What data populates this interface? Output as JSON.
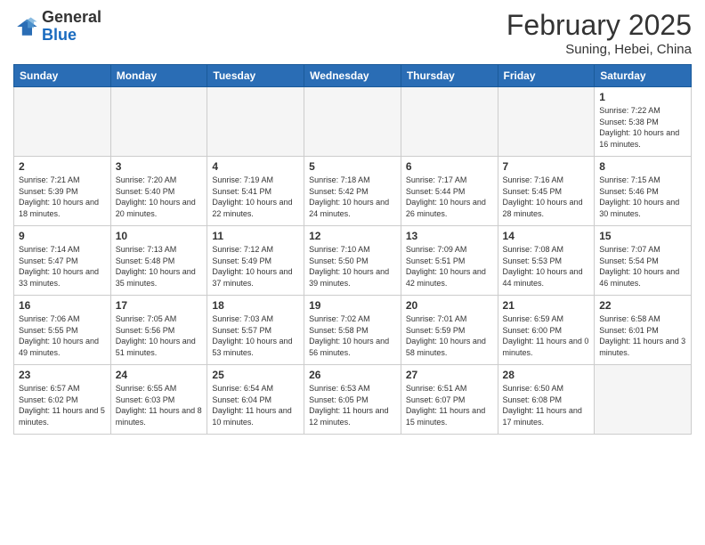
{
  "header": {
    "logo_general": "General",
    "logo_blue": "Blue",
    "title": "February 2025",
    "subtitle": "Suning, Hebei, China"
  },
  "weekdays": [
    "Sunday",
    "Monday",
    "Tuesday",
    "Wednesday",
    "Thursday",
    "Friday",
    "Saturday"
  ],
  "weeks": [
    [
      {
        "day": "",
        "info": ""
      },
      {
        "day": "",
        "info": ""
      },
      {
        "day": "",
        "info": ""
      },
      {
        "day": "",
        "info": ""
      },
      {
        "day": "",
        "info": ""
      },
      {
        "day": "",
        "info": ""
      },
      {
        "day": "1",
        "info": "Sunrise: 7:22 AM\nSunset: 5:38 PM\nDaylight: 10 hours\nand 16 minutes."
      }
    ],
    [
      {
        "day": "2",
        "info": "Sunrise: 7:21 AM\nSunset: 5:39 PM\nDaylight: 10 hours\nand 18 minutes."
      },
      {
        "day": "3",
        "info": "Sunrise: 7:20 AM\nSunset: 5:40 PM\nDaylight: 10 hours\nand 20 minutes."
      },
      {
        "day": "4",
        "info": "Sunrise: 7:19 AM\nSunset: 5:41 PM\nDaylight: 10 hours\nand 22 minutes."
      },
      {
        "day": "5",
        "info": "Sunrise: 7:18 AM\nSunset: 5:42 PM\nDaylight: 10 hours\nand 24 minutes."
      },
      {
        "day": "6",
        "info": "Sunrise: 7:17 AM\nSunset: 5:44 PM\nDaylight: 10 hours\nand 26 minutes."
      },
      {
        "day": "7",
        "info": "Sunrise: 7:16 AM\nSunset: 5:45 PM\nDaylight: 10 hours\nand 28 minutes."
      },
      {
        "day": "8",
        "info": "Sunrise: 7:15 AM\nSunset: 5:46 PM\nDaylight: 10 hours\nand 30 minutes."
      }
    ],
    [
      {
        "day": "9",
        "info": "Sunrise: 7:14 AM\nSunset: 5:47 PM\nDaylight: 10 hours\nand 33 minutes."
      },
      {
        "day": "10",
        "info": "Sunrise: 7:13 AM\nSunset: 5:48 PM\nDaylight: 10 hours\nand 35 minutes."
      },
      {
        "day": "11",
        "info": "Sunrise: 7:12 AM\nSunset: 5:49 PM\nDaylight: 10 hours\nand 37 minutes."
      },
      {
        "day": "12",
        "info": "Sunrise: 7:10 AM\nSunset: 5:50 PM\nDaylight: 10 hours\nand 39 minutes."
      },
      {
        "day": "13",
        "info": "Sunrise: 7:09 AM\nSunset: 5:51 PM\nDaylight: 10 hours\nand 42 minutes."
      },
      {
        "day": "14",
        "info": "Sunrise: 7:08 AM\nSunset: 5:53 PM\nDaylight: 10 hours\nand 44 minutes."
      },
      {
        "day": "15",
        "info": "Sunrise: 7:07 AM\nSunset: 5:54 PM\nDaylight: 10 hours\nand 46 minutes."
      }
    ],
    [
      {
        "day": "16",
        "info": "Sunrise: 7:06 AM\nSunset: 5:55 PM\nDaylight: 10 hours\nand 49 minutes."
      },
      {
        "day": "17",
        "info": "Sunrise: 7:05 AM\nSunset: 5:56 PM\nDaylight: 10 hours\nand 51 minutes."
      },
      {
        "day": "18",
        "info": "Sunrise: 7:03 AM\nSunset: 5:57 PM\nDaylight: 10 hours\nand 53 minutes."
      },
      {
        "day": "19",
        "info": "Sunrise: 7:02 AM\nSunset: 5:58 PM\nDaylight: 10 hours\nand 56 minutes."
      },
      {
        "day": "20",
        "info": "Sunrise: 7:01 AM\nSunset: 5:59 PM\nDaylight: 10 hours\nand 58 minutes."
      },
      {
        "day": "21",
        "info": "Sunrise: 6:59 AM\nSunset: 6:00 PM\nDaylight: 11 hours\nand 0 minutes."
      },
      {
        "day": "22",
        "info": "Sunrise: 6:58 AM\nSunset: 6:01 PM\nDaylight: 11 hours\nand 3 minutes."
      }
    ],
    [
      {
        "day": "23",
        "info": "Sunrise: 6:57 AM\nSunset: 6:02 PM\nDaylight: 11 hours\nand 5 minutes."
      },
      {
        "day": "24",
        "info": "Sunrise: 6:55 AM\nSunset: 6:03 PM\nDaylight: 11 hours\nand 8 minutes."
      },
      {
        "day": "25",
        "info": "Sunrise: 6:54 AM\nSunset: 6:04 PM\nDaylight: 11 hours\nand 10 minutes."
      },
      {
        "day": "26",
        "info": "Sunrise: 6:53 AM\nSunset: 6:05 PM\nDaylight: 11 hours\nand 12 minutes."
      },
      {
        "day": "27",
        "info": "Sunrise: 6:51 AM\nSunset: 6:07 PM\nDaylight: 11 hours\nand 15 minutes."
      },
      {
        "day": "28",
        "info": "Sunrise: 6:50 AM\nSunset: 6:08 PM\nDaylight: 11 hours\nand 17 minutes."
      },
      {
        "day": "",
        "info": ""
      }
    ]
  ]
}
